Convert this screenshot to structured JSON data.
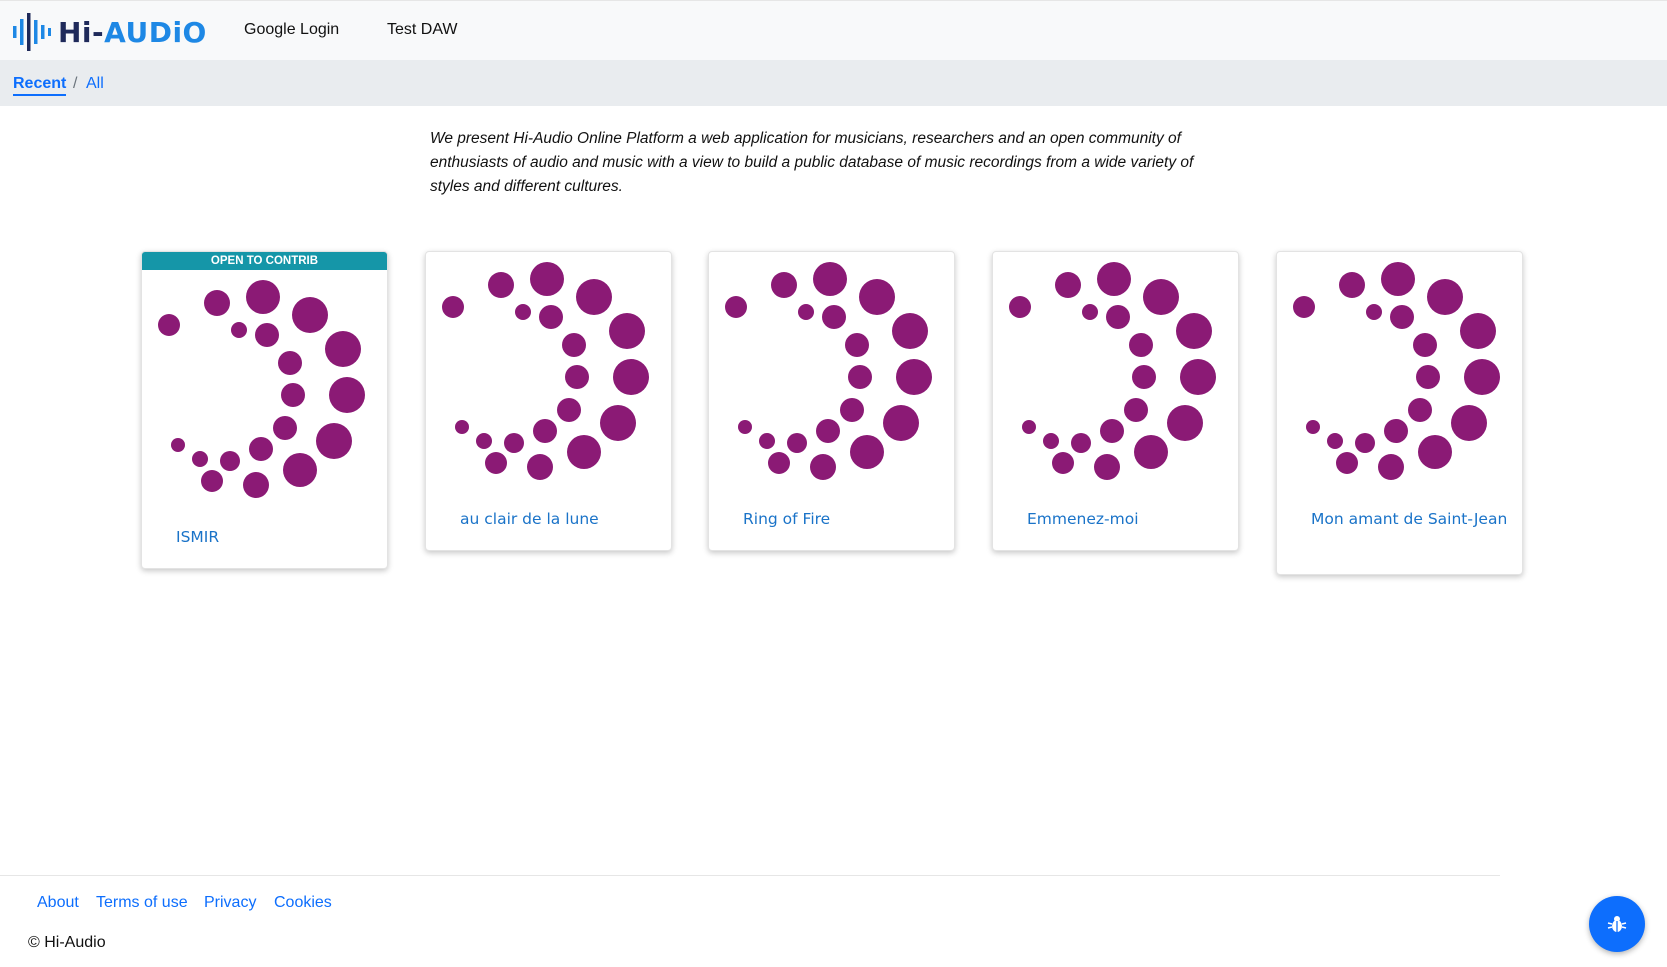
{
  "app": {
    "brand_prefix": "Hi-",
    "brand_suffix": "AUDiO"
  },
  "nav": {
    "google_login": "Google Login",
    "test_daw": "Test DAW"
  },
  "breadcrumb": {
    "recent": "Recent",
    "separator": "/",
    "all": "All"
  },
  "intro": "We present Hi-Audio Online Platform a web application for musicians, researchers and an open community of enthusiasts of audio and music with a view to build a public database of music recordings from a wide variety of styles and different cultures.",
  "cards": [
    {
      "badge": "OPEN TO CONTRIB",
      "title": "ISMIR"
    },
    {
      "title": "au clair de la lune"
    },
    {
      "title": "Ring of Fire"
    },
    {
      "title": "Emmenez-moi"
    },
    {
      "title": "Mon amant de Saint-Jean"
    }
  ],
  "footer": {
    "about": "About",
    "terms": "Terms of use",
    "privacy": "Privacy",
    "cookies": "Cookies",
    "copyright": "© Hi-Audio"
  },
  "colors": {
    "accent": "#0d6efd",
    "badge": "#1596a8",
    "dots": "#8b1a75",
    "card_title": "#1a73c8"
  },
  "icons": {
    "logo": "sound-wave-icon",
    "bug": "bug-icon",
    "card_art": "dot-crescent-icon"
  }
}
